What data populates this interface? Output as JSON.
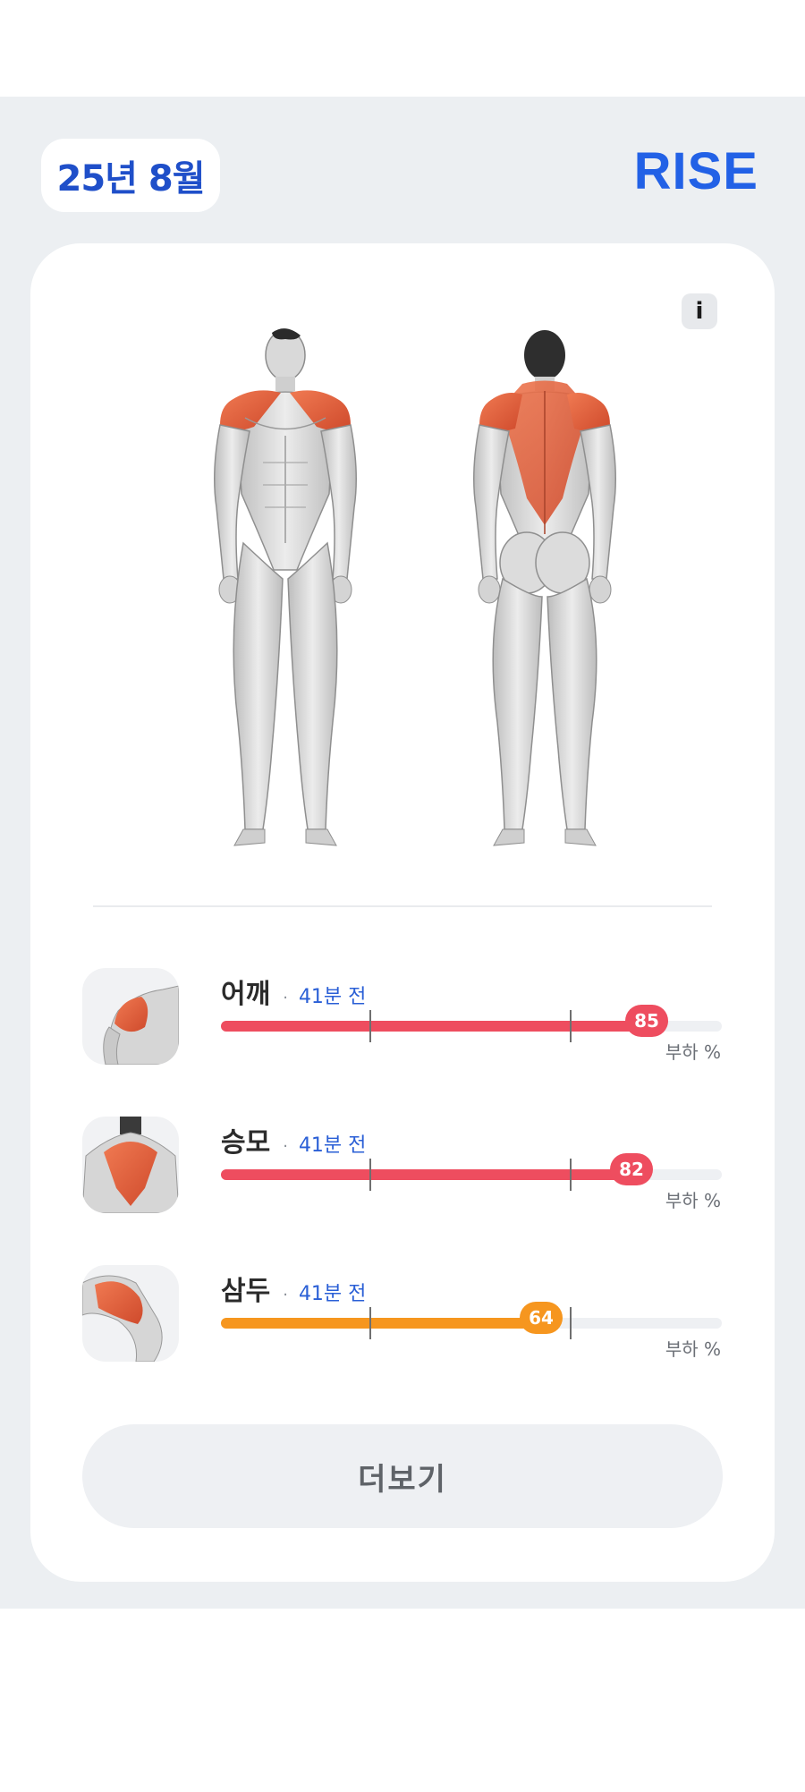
{
  "header": {
    "date_label": "25년 8월",
    "brand": "RISE"
  },
  "card": {
    "info_label": "i",
    "more_button": "더보기"
  },
  "muscles": [
    {
      "name": "어깨",
      "time_ago": "41분 전",
      "value": 85,
      "load_label": "부하 %",
      "color": "#ee4d5f"
    },
    {
      "name": "승모",
      "time_ago": "41분 전",
      "value": 82,
      "load_label": "부하 %",
      "color": "#ee4d5f"
    },
    {
      "name": "삼두",
      "time_ago": "41분 전",
      "value": 64,
      "load_label": "부하 %",
      "color": "#f6961f"
    }
  ],
  "colors": {
    "accent_blue": "#2261e6",
    "high_load": "#ee4d5f",
    "medium_load": "#f6961f",
    "muscle_highlight": "#e8603f"
  }
}
